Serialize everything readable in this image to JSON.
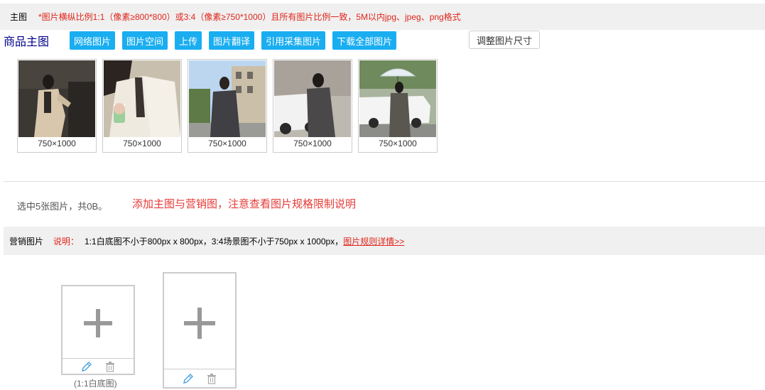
{
  "main_section": {
    "label": "主图",
    "hint": "*图片横纵比例1:1（像素≥800*800）或3:4（像素≥750*1000）且所有图片比例一致，5M以内jpg、jpeg、png格式"
  },
  "goods_images": {
    "title": "商品主图",
    "buttons": [
      "网络图片",
      "图片空间",
      "上传",
      "图片翻译",
      "引用采集图片",
      "下载全部图片"
    ],
    "resize_label": "调整图片尺寸",
    "thumbnails": [
      {
        "size": "750×1000",
        "scene": "woman-beige-coat-drinking"
      },
      {
        "size": "750×1000",
        "scene": "woman-white-coat-coffee"
      },
      {
        "size": "750×1000",
        "scene": "woman-gray-coat-street"
      },
      {
        "size": "750×1000",
        "scene": "woman-gray-coat-white-car"
      },
      {
        "size": "750×1000",
        "scene": "woman-umbrella-white-car"
      }
    ]
  },
  "selection": {
    "info": "选中5张图片，共0B。",
    "tip": "添加主图与营销图，注意查看图片规格限制说明"
  },
  "marketing": {
    "label": "营销图片",
    "note_label": "说明：",
    "note": "1:1白底图不小于800px x 800px，3:4场景图不小于750px x 1000px，",
    "link": "图片规则详情>>",
    "slots": [
      {
        "caption": "(1:1白底图)"
      },
      {
        "caption": ""
      }
    ]
  }
}
